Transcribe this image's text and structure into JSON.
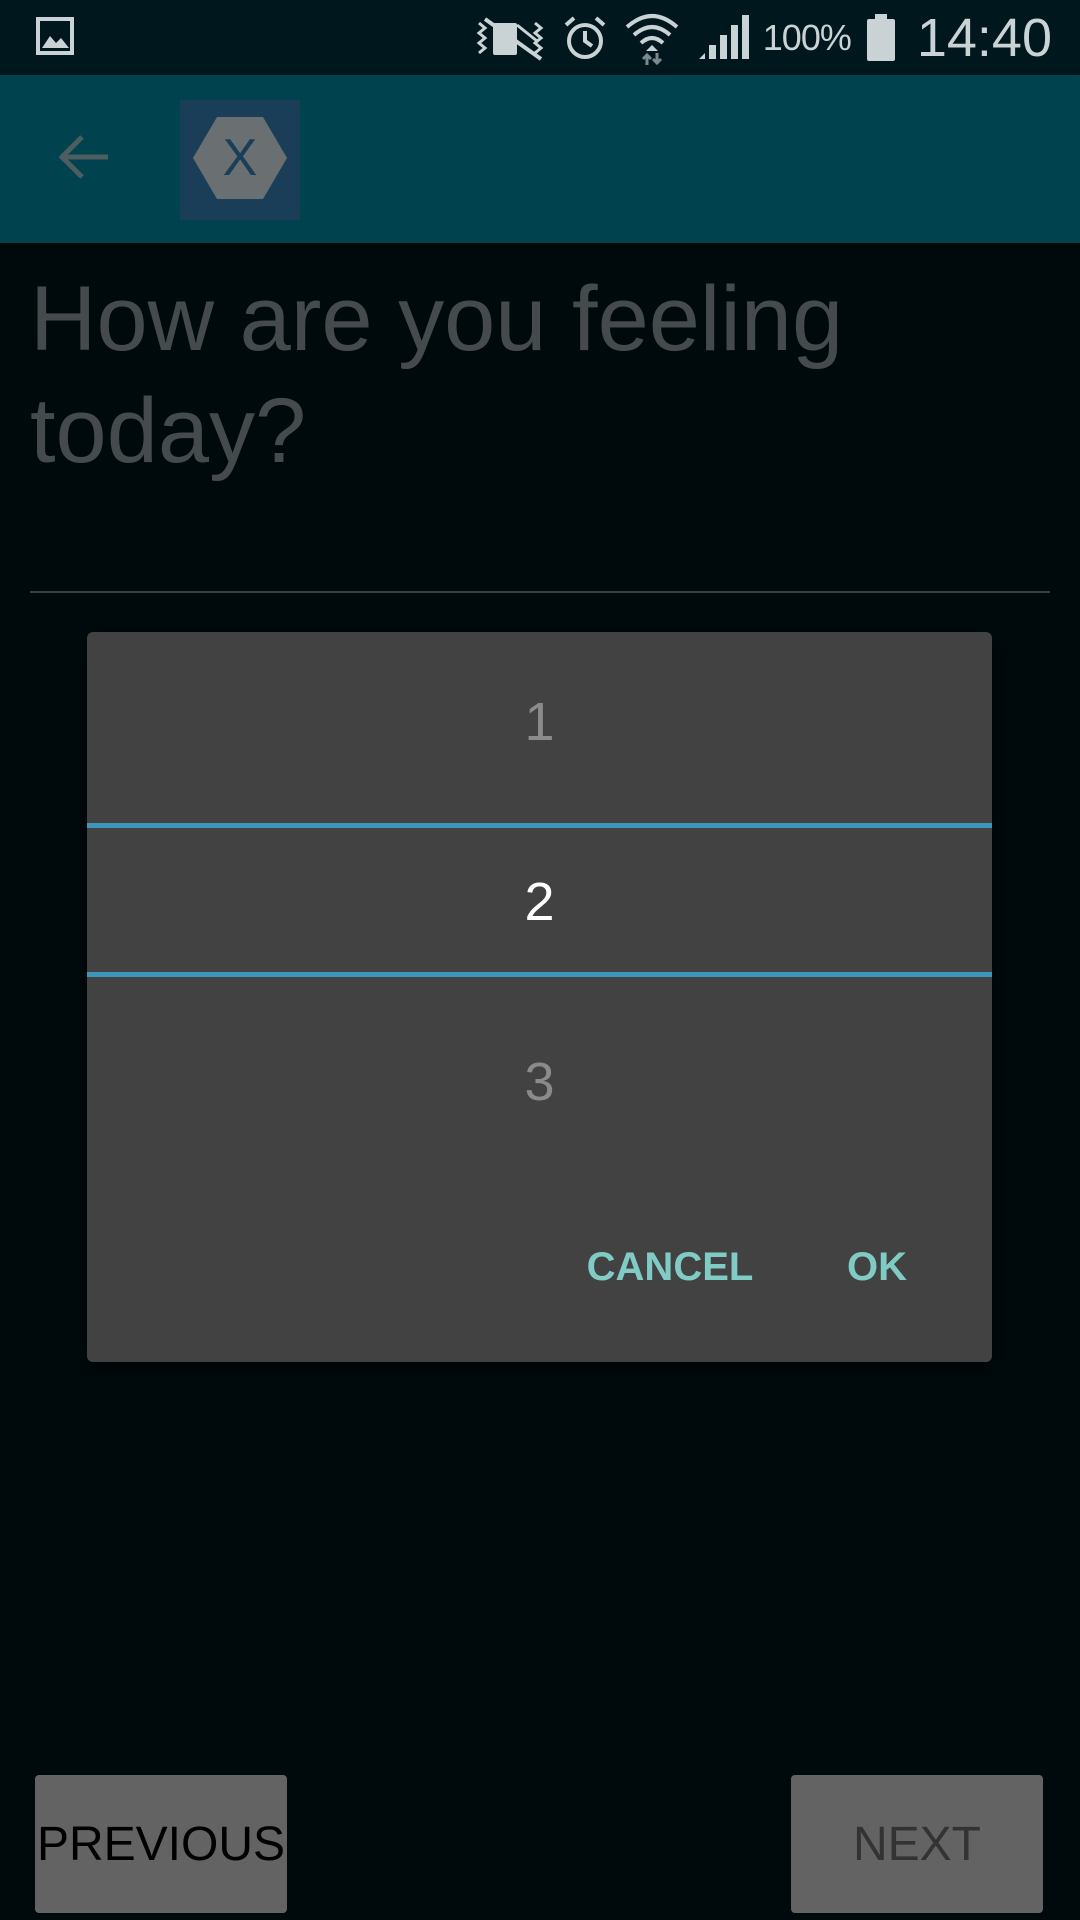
{
  "status_bar": {
    "battery_percent": "100%",
    "time": "14:40",
    "icons": [
      "gallery-icon",
      "vibrate-mute-icon",
      "alarm-icon",
      "wifi-icon",
      "signal-icon",
      "battery-icon"
    ]
  },
  "app_bar": {
    "back_icon": "arrow-back-icon",
    "logo_icon": "xamarin-logo-icon",
    "logo_letter": "X"
  },
  "page": {
    "question": "How are you feeling today?"
  },
  "dialog": {
    "picker": {
      "previous_value": "1",
      "selected_value": "2",
      "next_value": "3"
    },
    "cancel_label": "CANCEL",
    "ok_label": "OK"
  },
  "navigation": {
    "previous_label": "PREVIOUS",
    "next_label": "NEXT"
  },
  "colors": {
    "app_bar": "#00424d",
    "status_bar": "#00171d",
    "dialog_background": "#424242",
    "picker_divider": "#3c97bb",
    "dialog_button_text": "#80cbc4",
    "background": "#000a0d"
  }
}
